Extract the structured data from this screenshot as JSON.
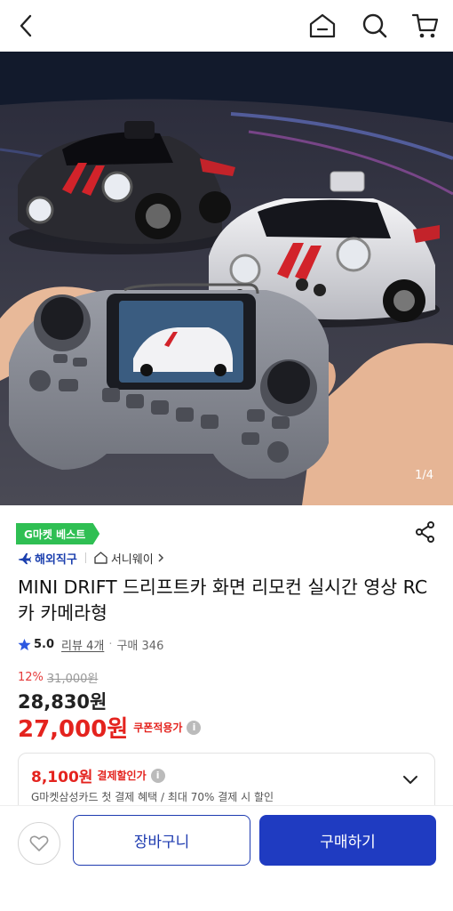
{
  "header": {
    "icons": [
      "back-icon",
      "home-icon",
      "search-icon",
      "cart-icon"
    ]
  },
  "hero": {
    "counter": "1/4",
    "image_alt": "MINI DRIFT RC car product photo"
  },
  "product": {
    "best_badge": "G마켓 베스트",
    "origin": "해외직구",
    "seller": "서니웨이",
    "title": "MINI DRIFT 드리프트카 화면 리모컨 실시간 영상 RC카 카메라형",
    "rating": "5.0",
    "review": "리뷰 4개",
    "sales": "구매 346",
    "discount_pct": "12%",
    "original_price": "31,000원",
    "sale_price": "28,830원",
    "coupon_price": "27,000원",
    "coupon_label": "쿠폰적용가",
    "pay_amount": "8,100원",
    "pay_label": "결제할인가",
    "pay_desc": "G마켓삼성카드 첫 결제 혜택 / 최대 70% 결제 시 할인"
  },
  "bottom": {
    "cart_label": "장바구니",
    "buy_label": "구매하기"
  },
  "colors": {
    "accent": "#1f3bc1",
    "price_red": "#e4231e",
    "badge_green": "#2fbf53"
  }
}
